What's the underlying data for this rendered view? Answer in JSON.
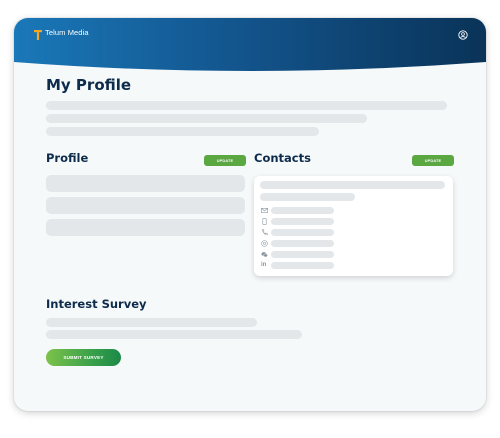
{
  "header": {
    "logo_text": "Telum Media",
    "brand_colors": {
      "start": "#1a78b8",
      "end": "#0a3358"
    },
    "user_icon": "user-circle-icon"
  },
  "page": {
    "title": "My Profile"
  },
  "profile": {
    "title": "Profile",
    "update_label": "UPDATE"
  },
  "contacts": {
    "title": "Contacts",
    "update_label": "UPDATE",
    "icons": [
      "mail-icon",
      "mobile-icon",
      "phone-icon",
      "at-sign-icon",
      "wechat-icon",
      "linkedin-icon"
    ],
    "linkedin_glyph": "in"
  },
  "survey": {
    "title": "Interest Survey",
    "submit_label": "SUBMIT SURVEY"
  },
  "colors": {
    "accent_green": "#5ba843",
    "title_navy": "#0d2b4a",
    "skeleton": "#e3e7ea"
  }
}
